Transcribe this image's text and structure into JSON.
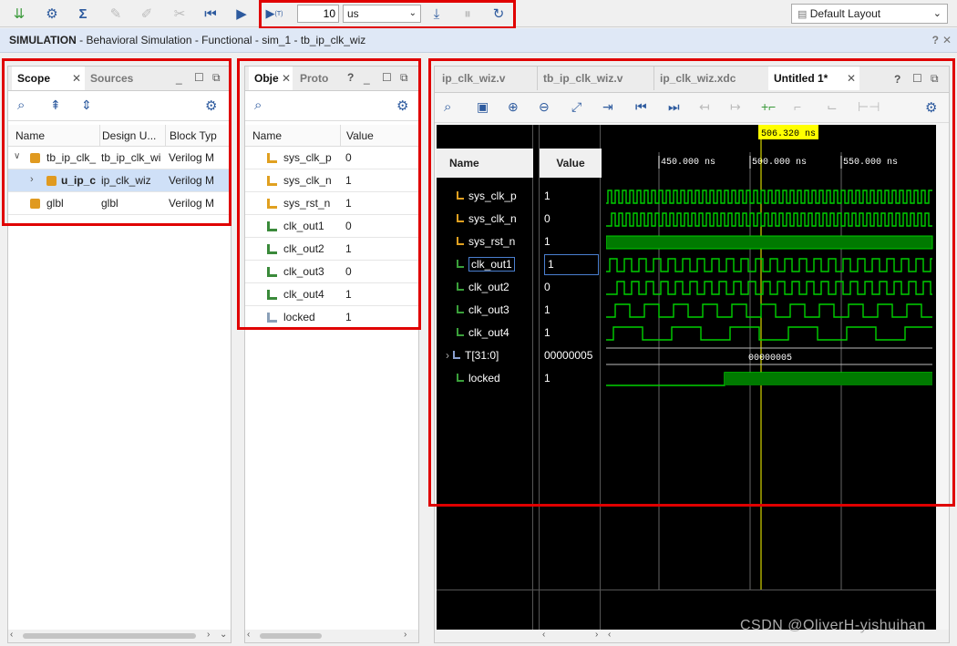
{
  "toolbar": {
    "run_time_value": "10",
    "run_time_unit": "us",
    "layout_select": "Default Layout"
  },
  "banner": {
    "prefix": "SIMULATION",
    "text": " - Behavioral Simulation - Functional - sim_1 - tb_ip_clk_wiz"
  },
  "scope": {
    "tabs": [
      "Scope",
      "Sources"
    ],
    "columns": [
      "Name",
      "Design U...",
      "Block Typ"
    ],
    "rows": [
      {
        "name": "tb_ip_clk_",
        "design": "tb_ip_clk_wi",
        "block": "Verilog M"
      },
      {
        "name": "u_ip_c",
        "design": "ip_clk_wiz",
        "block": "Verilog M"
      },
      {
        "name": "glbl",
        "design": "glbl",
        "block": "Verilog M"
      }
    ]
  },
  "objects": {
    "tabs": [
      "Obje",
      "Proto"
    ],
    "columns": [
      "Name",
      "Value"
    ],
    "rows": [
      {
        "name": "sys_clk_p",
        "value": "0"
      },
      {
        "name": "sys_clk_n",
        "value": "1"
      },
      {
        "name": "sys_rst_n",
        "value": "1"
      },
      {
        "name": "clk_out1",
        "value": "0"
      },
      {
        "name": "clk_out2",
        "value": "1"
      },
      {
        "name": "clk_out3",
        "value": "0"
      },
      {
        "name": "clk_out4",
        "value": "1"
      },
      {
        "name": "locked",
        "value": "1"
      }
    ]
  },
  "wave": {
    "tabs": [
      "ip_clk_wiz.v",
      "tb_ip_clk_wiz.v",
      "ip_clk_wiz.xdc",
      "Untitled 1*"
    ],
    "name_header": "Name",
    "value_header": "Value",
    "cursor_label": "506.320 ns",
    "time_labels": [
      "450.000 ns",
      "500.000 ns",
      "550.000 ns"
    ],
    "signals": [
      {
        "name": "sys_clk_p",
        "value": "1"
      },
      {
        "name": "sys_clk_n",
        "value": "0"
      },
      {
        "name": "sys_rst_n",
        "value": "1"
      },
      {
        "name": "clk_out1",
        "value": "1"
      },
      {
        "name": "clk_out2",
        "value": "0"
      },
      {
        "name": "clk_out3",
        "value": "1"
      },
      {
        "name": "clk_out4",
        "value": "1"
      },
      {
        "name": "T[31:0]",
        "value": "00000005"
      },
      {
        "name": "locked",
        "value": "1"
      }
    ],
    "bus_value": "00000005"
  },
  "watermark": "CSDN @OliverH-yishuihan",
  "colors": {
    "wave": "#00d000",
    "cursor": "#ffff00",
    "highlight_border": "#e00000"
  }
}
